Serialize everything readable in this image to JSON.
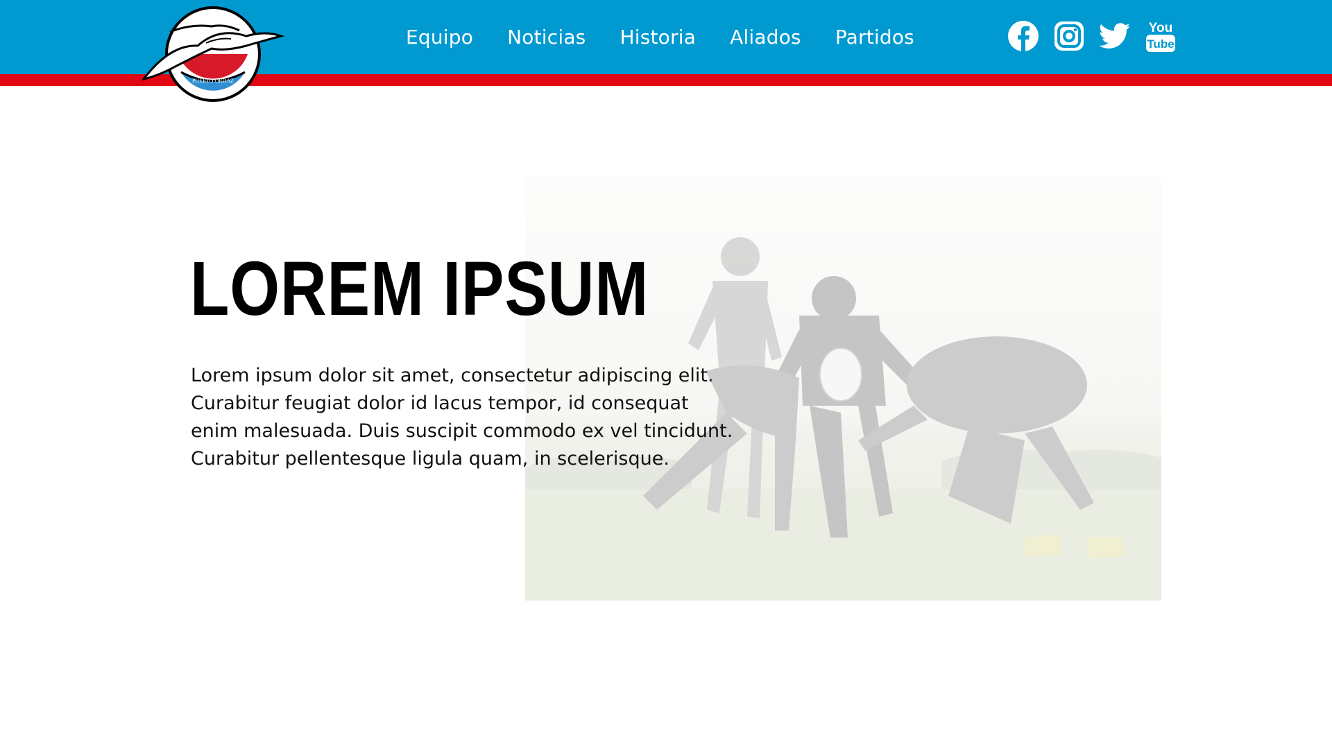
{
  "brand": {
    "logo_text": "PUERTO ORDAZ",
    "header_color": "#0099d0",
    "stripe_color": "#e10613"
  },
  "nav": {
    "items": [
      {
        "label": "Equipo"
      },
      {
        "label": "Noticias"
      },
      {
        "label": "Historia"
      },
      {
        "label": "Aliados"
      },
      {
        "label": "Partidos"
      }
    ]
  },
  "social": {
    "icons": [
      "facebook-icon",
      "instagram-icon",
      "twitter-icon",
      "youtube-icon"
    ],
    "youtube_top": "You",
    "youtube_bottom": "Tube"
  },
  "hero": {
    "title": "LOREM IPSUM",
    "paragraph_lines": [
      "Lorem ipsum dolor sit amet, consectetur adipiscing elit.",
      "Curabitur feugiat dolor id lacus tempor, id consequat",
      "enim malesuada. Duis suscipit commodo ex vel tincidunt.",
      "Curabitur pellentesque ligula quam, in scelerisque."
    ]
  }
}
